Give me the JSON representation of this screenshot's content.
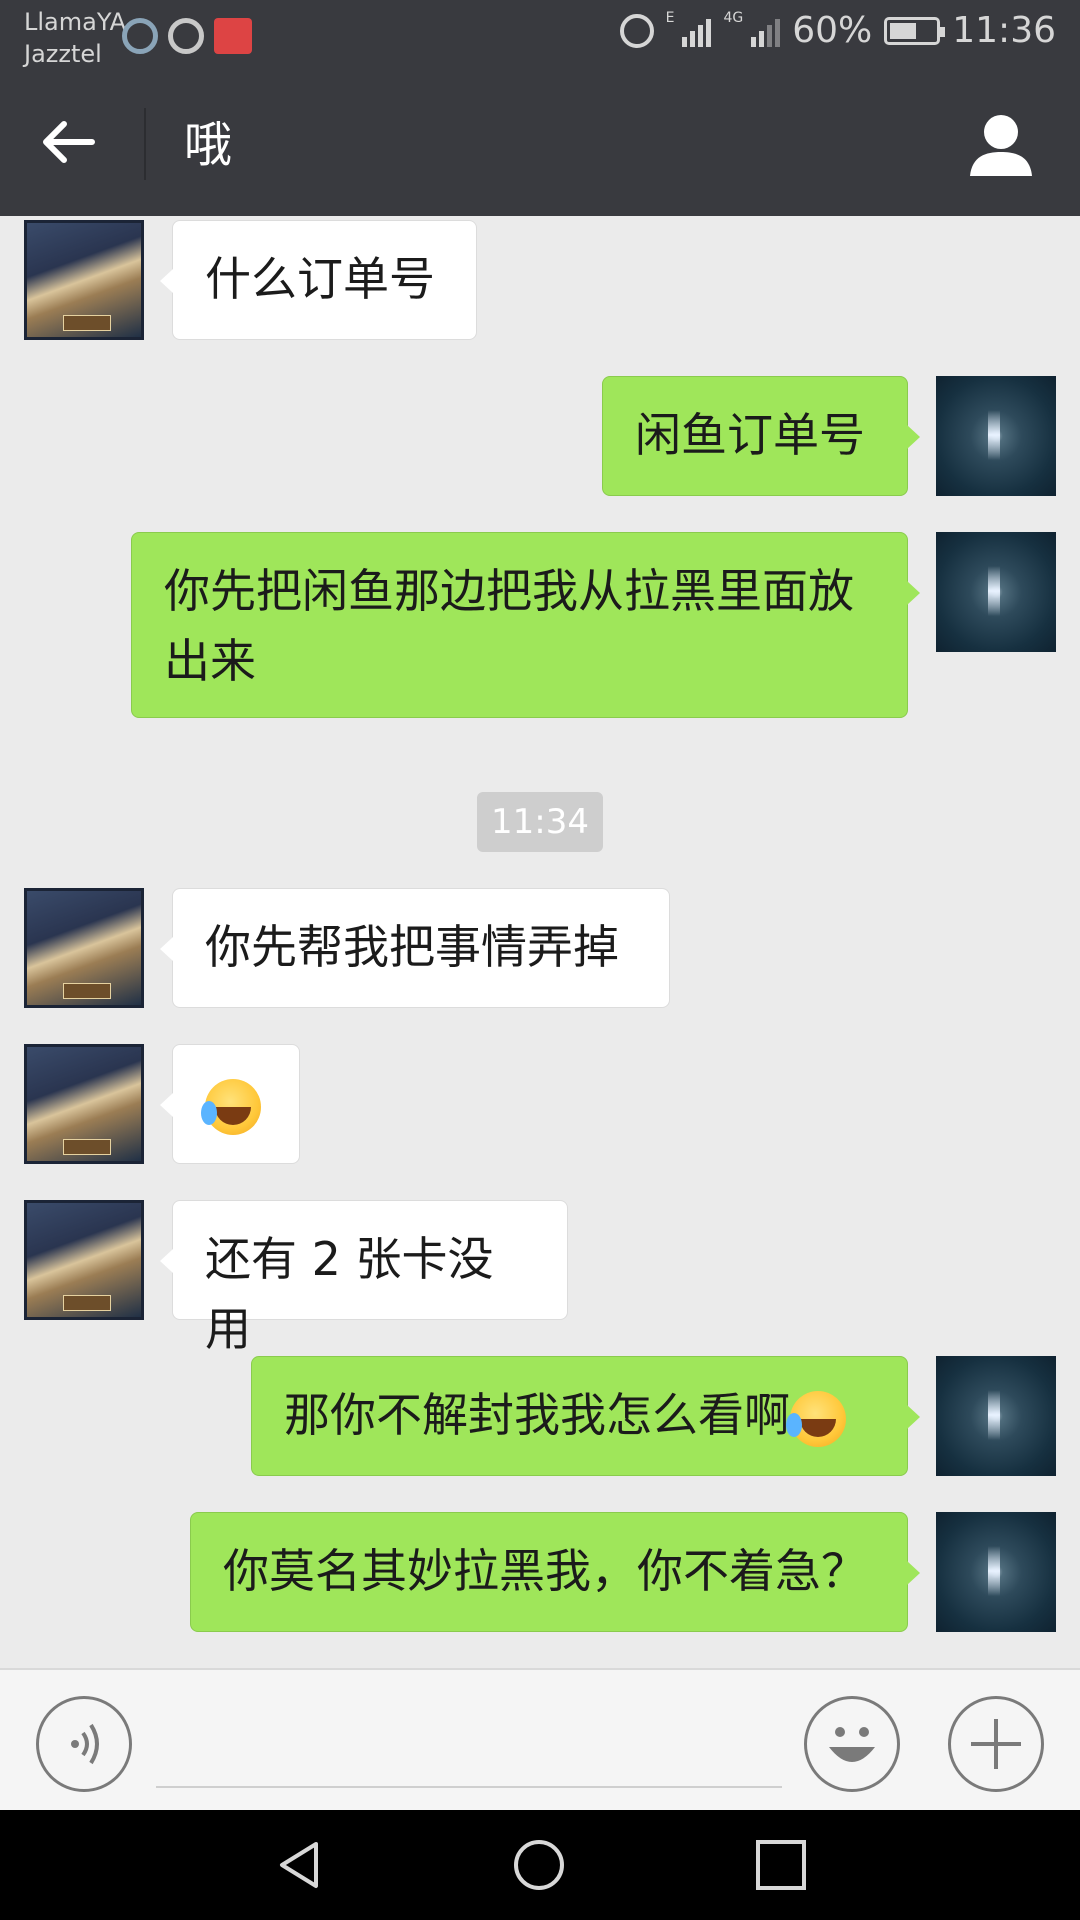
{
  "status_bar": {
    "carrier_line1": "LlamaYA",
    "carrier_line2": "Jazztel",
    "network_1": "E",
    "network_2": "4G",
    "battery_percent": "60%",
    "battery_level": 0.6,
    "time": "11:36",
    "icons": [
      "qq-browser-icon",
      "qq-icon",
      "video-app-icon",
      "alarm-icon",
      "signal-icon",
      "battery-icon"
    ]
  },
  "header": {
    "title": "哦",
    "back_icon": "arrow-left-icon",
    "contact_icon": "person-icon"
  },
  "messages": [
    {
      "side": "in",
      "text": "什么订单号"
    },
    {
      "side": "out",
      "text": "闲鱼订单号"
    },
    {
      "side": "out",
      "line1": "你先把闲鱼那边把我从拉黑里面放",
      "line2": "出来"
    },
    {
      "type": "time",
      "text": "11:34"
    },
    {
      "side": "in",
      "text": "你先帮我把事情弄掉"
    },
    {
      "side": "in",
      "emoji": "crying-laughing-emoji"
    },
    {
      "side": "in",
      "text": "还有 2 张卡没用"
    },
    {
      "side": "out",
      "text": "那你不解封我我怎么看啊",
      "emoji": "crying-laughing-emoji"
    },
    {
      "side": "out",
      "text": "你莫名其妙拉黑我，你不着急？"
    }
  ],
  "input_bar": {
    "voice_icon": "voice-icon",
    "emoji_icon": "smiley-icon",
    "plus_icon": "plus-icon"
  },
  "nav_bar": {
    "icons": [
      "nav-back-icon",
      "nav-home-icon",
      "nav-recents-icon"
    ]
  },
  "colors": {
    "header_bg": "#393a3f",
    "chat_bg": "#ebebeb",
    "outgoing_bubble": "#9fe65a",
    "incoming_bubble": "#ffffff",
    "time_badge": "#cecece"
  }
}
